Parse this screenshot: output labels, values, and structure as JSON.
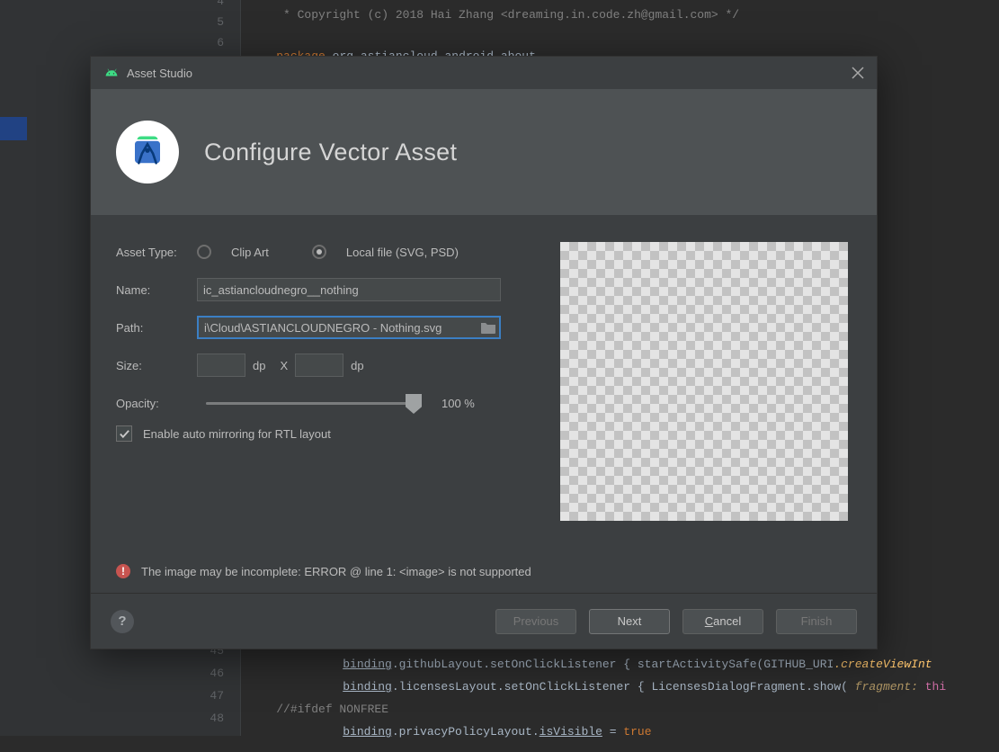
{
  "bg": {
    "lines": {
      "l4": "4",
      "l5": "5",
      "l6": "6",
      "l45": "45",
      "l46": "46",
      "l47": "47",
      "l48": "48"
    },
    "code4": " * Copyright (c) 2018 Hai Zhang <dreaming.in.code.zh@gmail.com> */",
    "code6_kw": "package ",
    "code6_rest": "org.astiancloud.android.about",
    "code45_a": "binding",
    "code45_b": ".githubLayout",
    "code45_c": ".setOnClickListener { startActivitySafe(GITHUB_URI",
    "code45_d": ".createViewInt",
    "code46_a": "binding",
    "code46_b": ".licensesLayout",
    "code46_c": ".setOnClickListener { LicensesDialogFragment.show( ",
    "code46_frag": "fragment: ",
    "code46_this": "thi",
    "code47": "//#ifdef NONFREE",
    "code48_a": "binding",
    "code48_b": ".privacyPolicyLayout",
    "code48_c": ".",
    "code48_d": "isVisible",
    "code48_e": " = ",
    "code48_f": "true"
  },
  "dlg": {
    "title": "Asset Studio",
    "heading": "Configure Vector Asset",
    "labels": {
      "assetType": "Asset Type:",
      "clipArt": "Clip Art",
      "localFile": "Local file (SVG, PSD)",
      "name": "Name:",
      "path": "Path:",
      "size": "Size:",
      "dp": "dp",
      "x": "X",
      "opacity": "Opacity:",
      "opacityVal": "100 %",
      "autoMirror": "Enable auto mirroring for RTL layout"
    },
    "values": {
      "name": "ic_astiancloudnegro__nothing",
      "path": "i\\Cloud\\ASTIANCLOUDNEGRO - Nothing.svg",
      "sizeW": "",
      "sizeH": ""
    },
    "error": "The image may be incomplete: ERROR @ line 1: <image> is not supported",
    "buttons": {
      "help": "?",
      "previous": "Previous",
      "next": "Next",
      "cancel_m": "C",
      "cancel_rest": "ancel",
      "finish": "Finish"
    }
  }
}
